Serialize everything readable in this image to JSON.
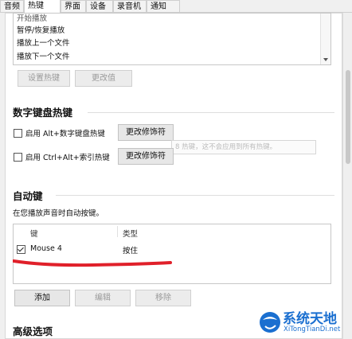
{
  "tabs": [
    "音频",
    "热键",
    "界面",
    "设备",
    "录音机",
    "通知"
  ],
  "active_tab": "热键",
  "hotkey_list": {
    "items": [
      "开始播放",
      "暂停/恢复播放",
      "播放上一个文件",
      "播放下一个文件"
    ]
  },
  "hotkey_buttons": {
    "set_hotkey": "设置热键",
    "change_value": "更改值"
  },
  "numpad_section": {
    "title": "数字键盘热键",
    "option1_label": "启用 Alt+数字键盘热键",
    "option2_label": "启用 Ctrl+Alt+索引热键",
    "modifier_button": "更改修饰符",
    "tooltip_text": "8 热键，这不会应用到所有热键。"
  },
  "autokey_section": {
    "title": "自动键",
    "description": "在您播放声音时自动按键。",
    "columns": [
      "键",
      "类型"
    ],
    "rows": [
      {
        "checked": true,
        "key": "Mouse 4",
        "type": "按住"
      }
    ],
    "buttons": {
      "add": "添加",
      "edit": "编辑",
      "remove": "移除"
    }
  },
  "advanced_section": {
    "title": "高级选项"
  },
  "watermark": {
    "title": "系统天地",
    "url": "XiTongTianDi.net"
  },
  "colors": {
    "accent_underline": "#e0202a",
    "watermark_blue": "#1a6fd0"
  }
}
